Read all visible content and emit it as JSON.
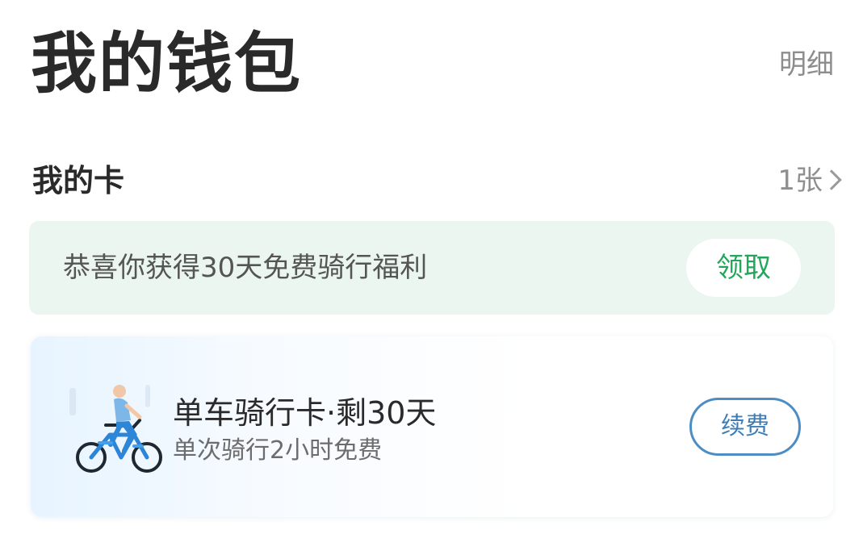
{
  "header": {
    "title": "我的钱包",
    "detail_label": "明细"
  },
  "cards_section": {
    "title": "我的卡",
    "count_label": "1张"
  },
  "promo": {
    "text": "恭喜你获得30天免费骑行福利",
    "claim_label": "领取"
  },
  "bike_card": {
    "title": "单车骑行卡·剩30天",
    "subtitle": "单次骑行2小时免费",
    "renew_label": "续费"
  },
  "icons": {
    "bike": "bike-rider-icon",
    "chevron": "chevron-right-icon"
  },
  "colors": {
    "promo_background": "#eaf6ef",
    "claim_text": "#21a65a",
    "renew_border": "#4e8dc4"
  }
}
